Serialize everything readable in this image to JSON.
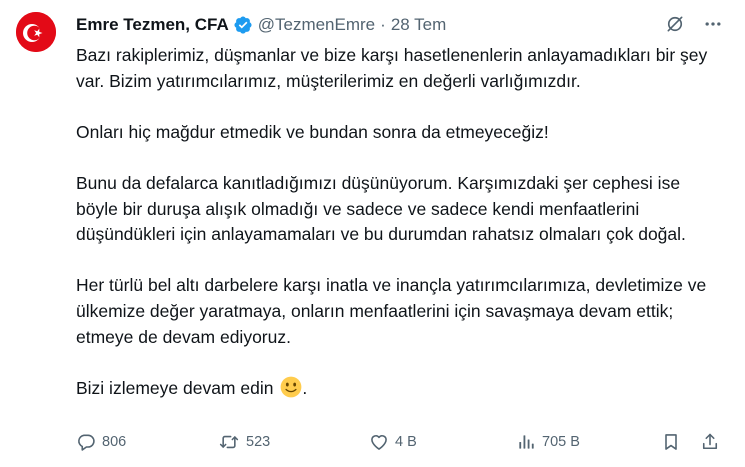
{
  "author": {
    "name": "Emre Tezmen, CFA",
    "handle": "@TezmenEmre",
    "separator": "·",
    "date": "28 Tem"
  },
  "body": {
    "paragraphs": [
      "Bazı rakiplerimiz, düşmanlar ve bize karşı hasetlenenlerin anlayamadıkları bir şey var.  Bizim yatırımcılarımız, müşterilerimiz en değerli varlığımızdır.",
      "Onları hiç mağdur etmedik ve bundan sonra da etmeyeceğiz!",
      "Bunu da defalarca kanıtladığımızı düşünüyorum. Karşımızdaki şer cephesi ise böyle bir duruşa alışık olmadığı ve sadece ve sadece kendi menfaatlerini düşündükleri için anlayamamaları ve bu durumdan rahatsız olmaları çok doğal.",
      "Her türlü bel altı darbelere karşı inatla ve inançla yatırımcılarımıza, devletimize ve ülkemize değer yaratmaya, onların menfaatlerini için savaşmaya devam ettik; etmeye de devam ediyoruz.",
      "Bizi izlemeye devam edin"
    ],
    "closing_emoji": "slightly-smiling-face-emoji"
  },
  "actions": {
    "replies": "806",
    "reposts": "523",
    "likes": "4 B",
    "views": "705 B"
  },
  "icons": {
    "verified": "verified-badge-icon",
    "grok": "grok-icon",
    "more": "more-icon",
    "reply": "reply-icon",
    "repost": "repost-icon",
    "like": "like-icon",
    "views": "views-icon",
    "bookmark": "bookmark-icon",
    "share": "share-icon"
  },
  "colors": {
    "text": "#0f1419",
    "secondary": "#536471",
    "verified": "#1d9bf0",
    "flag_red": "#e30a17",
    "emoji": "#ffcc4d"
  }
}
